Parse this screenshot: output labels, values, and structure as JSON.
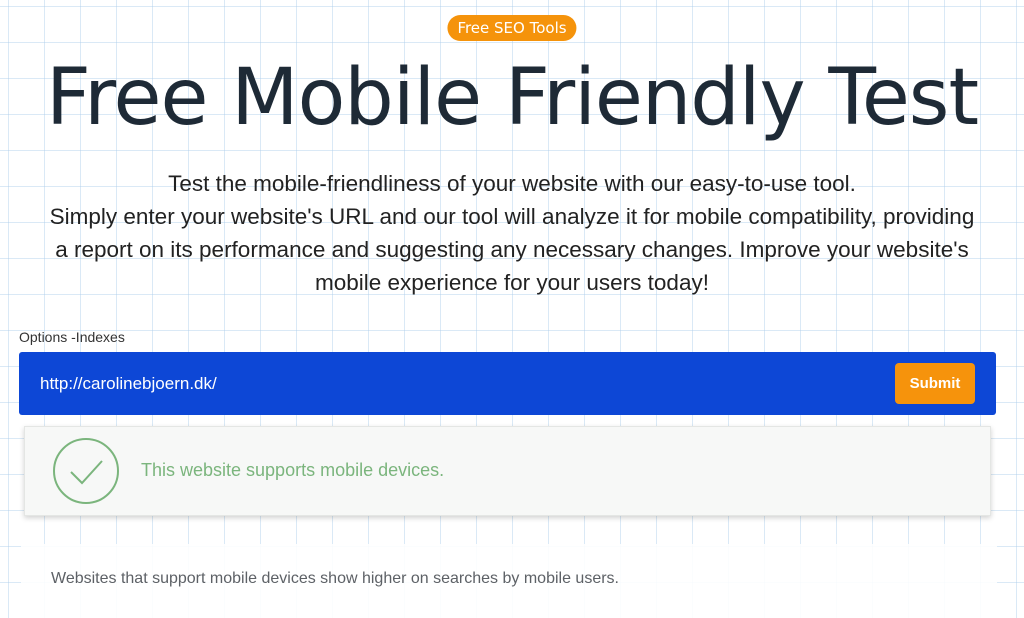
{
  "badge": {
    "label": "Free SEO Tools"
  },
  "hero": {
    "title": "Free Mobile Friendly Test",
    "description_lines": [
      "Test the mobile-friendliness of your website with our easy-to-use tool.",
      "Simply enter your website's URL and our tool will analyze it for mobile compatibility, providing",
      "a report on its performance and suggesting any necessary changes. Improve your website's",
      "mobile experience for your users today!"
    ]
  },
  "form": {
    "options_label": "Options -Indexes",
    "url_value": "http://carolinebjoern.dk/",
    "submit_label": "Submit"
  },
  "result": {
    "icon": "check-circle-icon",
    "message": "This website supports mobile devices."
  },
  "info": {
    "text": "Websites that support mobile devices show higher on searches by mobile users."
  },
  "colors": {
    "accent_orange": "#f6930c",
    "url_bar_blue": "#0d47d6",
    "success_green": "#7bb57d",
    "title_dark": "#1e2a36"
  }
}
